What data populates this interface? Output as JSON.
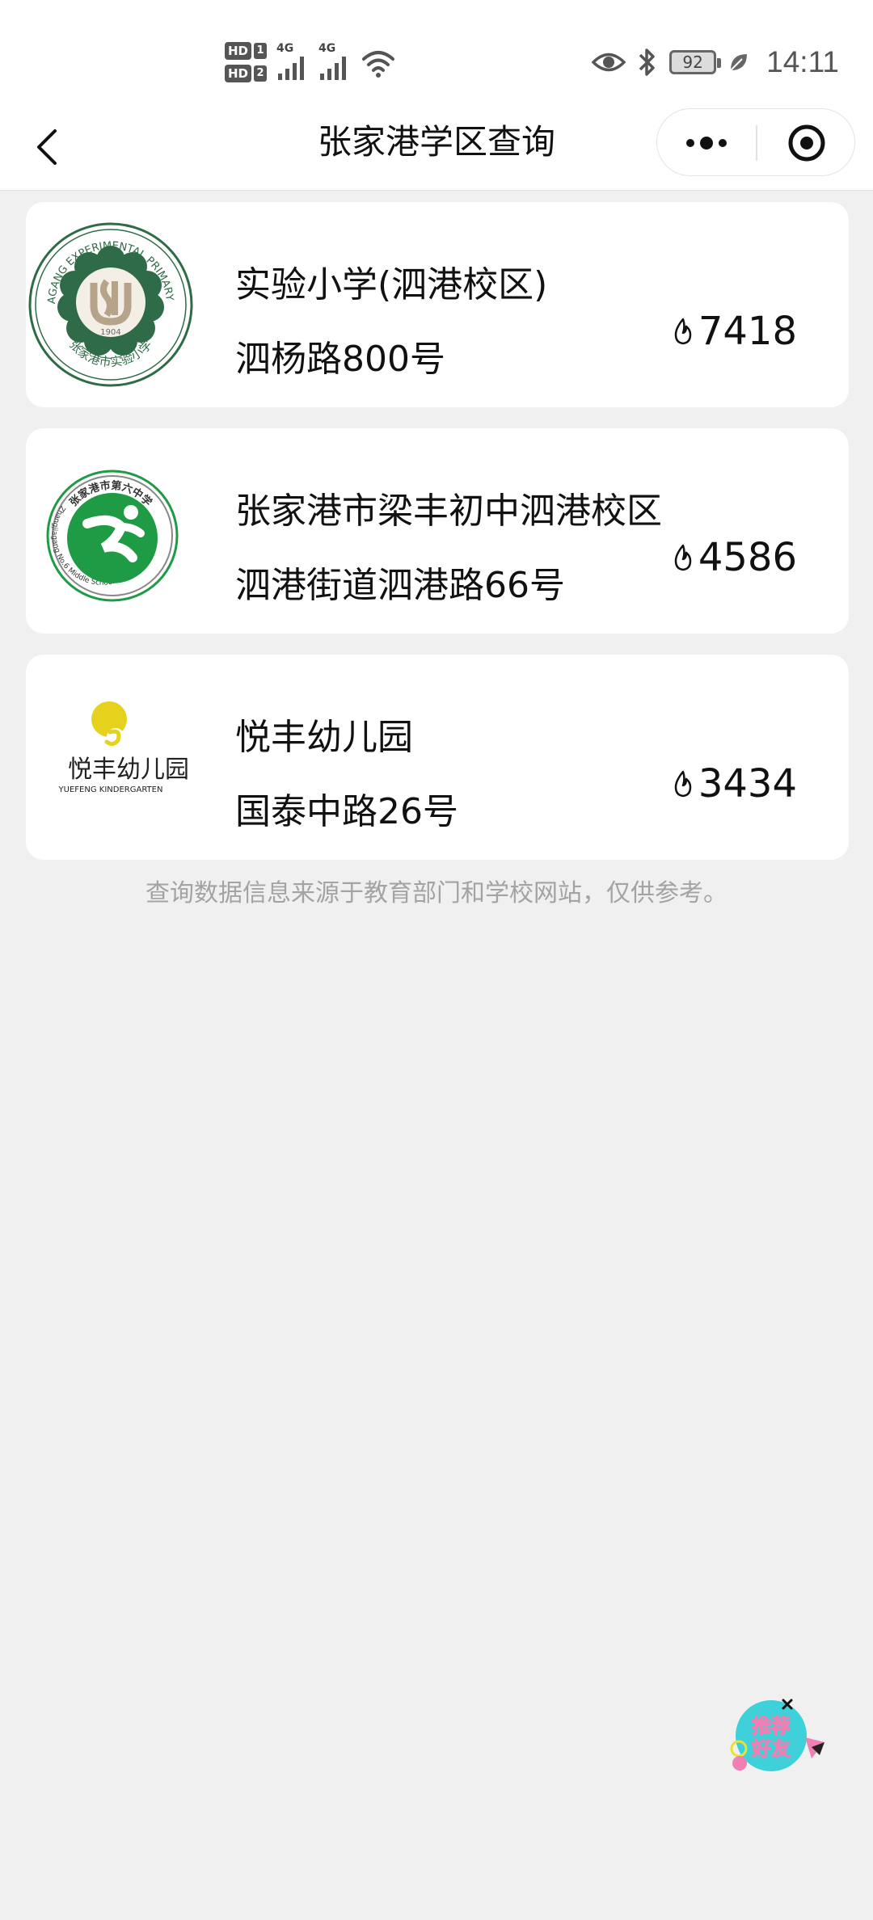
{
  "status_bar": {
    "sim1": "HD",
    "sim1_num": "1",
    "sim2": "HD",
    "sim2_num": "2",
    "net1": "4G",
    "net2": "4G",
    "battery": "92",
    "time": "14:11"
  },
  "navbar": {
    "title": "张家港学区查询"
  },
  "schools": [
    {
      "name": "实验小学(泗港校区)",
      "address": "泗杨路800号",
      "views": "7418",
      "logo": "zhangjiagang-experimental-primary-school-logo"
    },
    {
      "name": "张家港市梁丰初中泗港校区",
      "address": "泗港街道泗港路66号",
      "views": "4586",
      "logo": "zhangjiagang-no6-middle-school-logo"
    },
    {
      "name": "悦丰幼儿园",
      "address": "国泰中路26号",
      "views": "3434",
      "logo": "yuefeng-kindergarten-logo"
    }
  ],
  "disclaimer": "查询数据信息来源于教育部门和学校网站，仅供参考。",
  "logos": {
    "school1_top": "ZHANGJIAGANG EXPERIMENTAL PRIMARY SCHOOL",
    "school1_bottom": "张家港市实验小学",
    "school1_year": "1904",
    "school2_top": "张家港市第六中学",
    "school2_side": "Zhangjiagang No.6 Middle School",
    "school3_cn": "悦丰幼儿园",
    "school3_en": "YUEFENG KINDERGARTEN"
  },
  "float_button": {
    "label_line1": "推荐",
    "label_line2": "好友"
  },
  "colors": {
    "school1_green": "#2e6b46",
    "school2_green": "#1f9a45",
    "kindergarten_yellow": "#e6d21c",
    "share_teal": "#3fd1d9",
    "share_pink": "#f07fb4"
  }
}
